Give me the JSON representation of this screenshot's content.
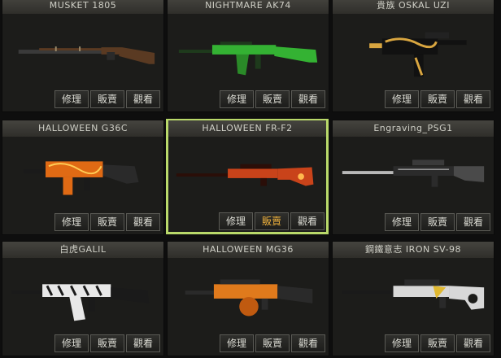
{
  "actions": {
    "repair": "修理",
    "sell": "販賣",
    "view": "觀看"
  },
  "cards": [
    {
      "name": "MUSKET 1805",
      "icon": "musket-rifle",
      "colors": {
        "body": "#5a3a22",
        "metal": "#2a2a2a"
      }
    },
    {
      "name": "NIGHTMARE AK74",
      "icon": "assault-rifle-ak",
      "colors": {
        "body": "#34b233",
        "metal": "#1e3a1c"
      }
    },
    {
      "name": "貴族 OSKAL UZI",
      "icon": "submachine-gun",
      "colors": {
        "body": "#111111",
        "metal": "#d9a640"
      }
    },
    {
      "name": "HALLOWEEN G36C",
      "icon": "assault-rifle-g36",
      "colors": {
        "body": "#e06a14",
        "metal": "#1a1a1a"
      }
    },
    {
      "name": "HALLOWEEN FR-F2",
      "icon": "sniper-rifle-frf2",
      "colors": {
        "body": "#c9431a",
        "metal": "#2a0e08"
      },
      "selected": true,
      "active_action": "sell"
    },
    {
      "name": "Engraving_PSG1",
      "icon": "sniper-rifle-psg1",
      "colors": {
        "body": "#2b2b2b",
        "metal": "#b8b8b8"
      }
    },
    {
      "name": "白虎GALIL",
      "icon": "assault-rifle-galil",
      "colors": {
        "body": "#e8e8e8",
        "metal": "#1a1a1a"
      }
    },
    {
      "name": "HALLOWEEN MG36",
      "icon": "machine-gun-mg36",
      "colors": {
        "body": "#e07a1c",
        "metal": "#2a2a2a"
      }
    },
    {
      "name": "鋼鐵意志 IRON SV-98",
      "icon": "sniper-rifle-sv98",
      "colors": {
        "body": "#d8d8d8",
        "metal": "#e0b830"
      }
    }
  ]
}
